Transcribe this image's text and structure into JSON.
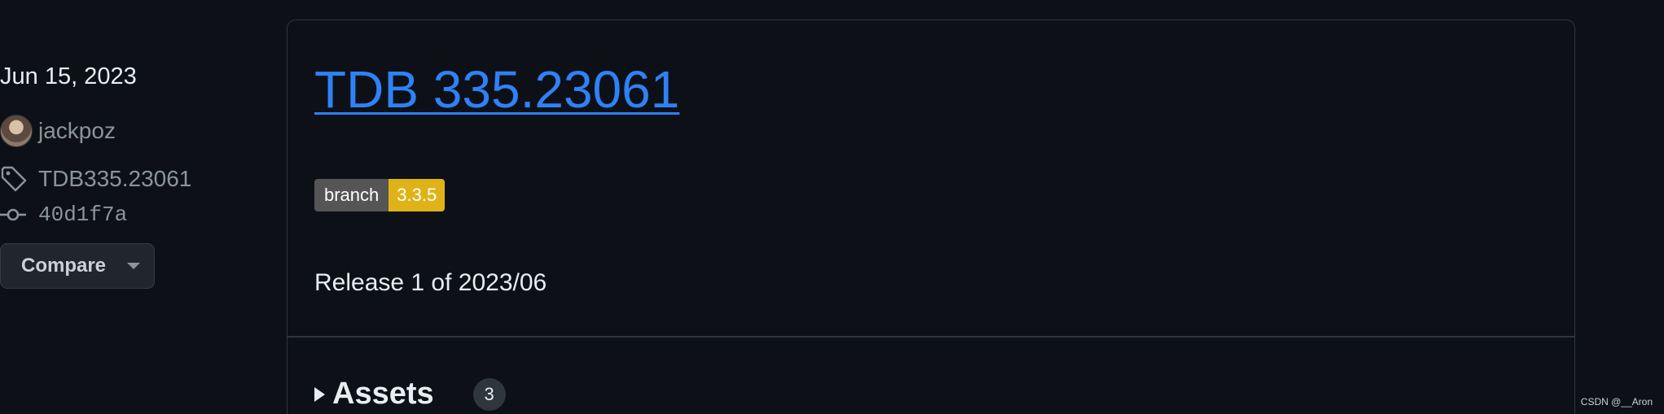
{
  "sidebar": {
    "date": "Jun 15, 2023",
    "author": "jackpoz",
    "tag": "TDB335.23061",
    "commit": "40d1f7a",
    "compare_label": "Compare"
  },
  "release": {
    "title": "TDB 335.23061",
    "badge": {
      "label": "branch",
      "value": "3.3.5",
      "value_color": "#dfb317"
    },
    "description": "Release 1 of 2023/06",
    "assets_label": "Assets",
    "assets_count": "3"
  },
  "icons": {
    "tag": "tag-icon",
    "commit": "git-commit-icon",
    "caret": "caret-down-icon",
    "disclosure": "disclosure-triangle-icon"
  },
  "colors": {
    "background": "#0d1117",
    "link": "#2f81f7",
    "muted": "#8b949e",
    "border": "#30363d"
  },
  "watermark": "CSDN @__Aron"
}
